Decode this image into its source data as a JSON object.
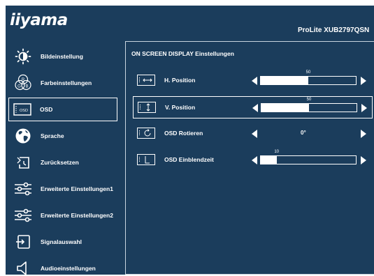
{
  "header": {
    "brand": "iiyama",
    "model": "ProLite XUB2797QSN"
  },
  "sidebar": {
    "items": [
      {
        "label": "Bildeinstellung",
        "icon": "brightness-icon"
      },
      {
        "label": "Farbeinstellungen",
        "icon": "rgb-color-icon"
      },
      {
        "label": "OSD",
        "icon": "osd-icon",
        "selected": true
      },
      {
        "label": "Sprache",
        "icon": "globe-icon"
      },
      {
        "label": "Zurücksetzen",
        "icon": "reset-icon"
      },
      {
        "label": "Erweiterte Einstellungen1",
        "icon": "sliders-icon"
      },
      {
        "label": "Erweiterte Einstellungen2",
        "icon": "sliders-icon"
      },
      {
        "label": "Signalauswahl",
        "icon": "input-signal-icon"
      },
      {
        "label": "Audioeinstellungen",
        "icon": "speaker-icon"
      }
    ],
    "osd_icon_text": "OSD",
    "rgb_letters": {
      "r": "R",
      "g": "G",
      "b": "B"
    }
  },
  "panel": {
    "title": "ON SCREEN DISPLAY Einstellungen",
    "rows": [
      {
        "label": "H. Position",
        "icon": "horizontal-position-icon",
        "type": "slider",
        "value": "50",
        "level": 50,
        "max": 100
      },
      {
        "label": "V. Position",
        "icon": "vertical-position-icon",
        "type": "slider",
        "value": "50",
        "level": 50,
        "max": 100,
        "selected": true
      },
      {
        "label": "OSD Rotieren",
        "icon": "rotate-icon",
        "type": "option",
        "value": "0°"
      },
      {
        "label": "OSD Einblendzeit",
        "icon": "timeout-icon",
        "type": "slider",
        "value": "10",
        "level": 10,
        "max": 60
      }
    ]
  },
  "colors": {
    "background": "#1b3d5c",
    "foreground": "#ffffff"
  }
}
